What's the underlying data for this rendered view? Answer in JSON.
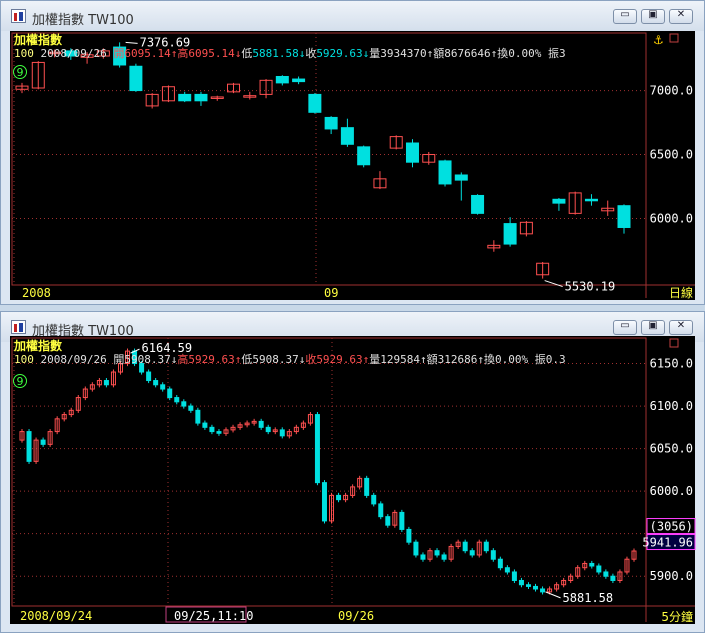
{
  "windows": [
    {
      "title": "加權指數 TW100",
      "symbol": "100",
      "date": "2008/09/26",
      "chart_name": "加權指數",
      "open_label": "開",
      "open": "6095.14",
      "high_label": "高",
      "high": "6095.14",
      "low_label": "低",
      "low": "5881.58",
      "close_label": "收",
      "close": "5929.63",
      "volume_label": "量",
      "volume": "3934370",
      "amount_label": "額",
      "amount": "8676646",
      "turnover_label": "換",
      "turnover": "0.00%",
      "amplitude_label": "振",
      "amplitude": "3",
      "arrow_up": "↑",
      "arrow_down": "↓",
      "marker": "9",
      "period": "日線",
      "x_labels": [
        "2008",
        "09"
      ],
      "high_annotation": "7376.69",
      "low_annotation": "5530.19"
    },
    {
      "title": "加權指數 TW100",
      "symbol": "100",
      "date": "2008/09/26",
      "chart_name": "加權指數",
      "open_label": "開",
      "open": "5908.37",
      "high_label": "高",
      "high": "5929.63",
      "low_label": "低",
      "low": "5908.37",
      "close_label": "收",
      "close": "5929.63",
      "volume_label": "量",
      "volume": "129584",
      "amount_label": "額",
      "amount": "312686",
      "turnover_label": "換",
      "turnover": "0.00%",
      "amplitude_label": "振",
      "amplitude": "0.3",
      "arrow_up": "↑",
      "arrow_down": "↓",
      "marker": "9",
      "period": "5分鐘",
      "x_labels": [
        "2008/09/24",
        "09/25,11:10",
        "09/26"
      ],
      "high_annotation": "6164.59",
      "low_annotation": "5881.58",
      "cursor_count": "(3056)",
      "cursor_price": "5941.96"
    }
  ],
  "controls": {
    "minimize": "▭",
    "restore": "▣",
    "close": "✕"
  },
  "colors": {
    "up": "#ff5050",
    "down": "#00e0e0",
    "grid": "#a03030",
    "axis": "#ffffff",
    "bg": "#000000"
  },
  "chart_data": [
    {
      "type": "candlestick",
      "title": "加權指數 TW100 日線",
      "ylim": [
        5480,
        7450
      ],
      "y_ticks": [
        6000.0,
        6500.0,
        7000.0
      ],
      "candles": [
        {
          "o": 7010,
          "h": 7060,
          "l": 6980,
          "c": 7035,
          "dir": "up"
        },
        {
          "o": 7020,
          "h": 7230,
          "l": 7010,
          "c": 7220,
          "dir": "up"
        },
        {
          "o": 7300,
          "h": 7320,
          "l": 7260,
          "c": 7300,
          "dir": "up"
        },
        {
          "o": 7310,
          "h": 7330,
          "l": 7240,
          "c": 7270,
          "dir": "down"
        },
        {
          "o": 7260,
          "h": 7300,
          "l": 7210,
          "c": 7280,
          "dir": "up"
        },
        {
          "o": 7270,
          "h": 7330,
          "l": 7250,
          "c": 7310,
          "dir": "up"
        },
        {
          "o": 7340,
          "h": 7376.69,
          "l": 7180,
          "c": 7200,
          "dir": "down"
        },
        {
          "o": 7190,
          "h": 7210,
          "l": 6990,
          "c": 7000,
          "dir": "down"
        },
        {
          "o": 6880,
          "h": 6980,
          "l": 6860,
          "c": 6970,
          "dir": "up"
        },
        {
          "o": 6920,
          "h": 7040,
          "l": 6910,
          "c": 7030,
          "dir": "up"
        },
        {
          "o": 6970,
          "h": 6990,
          "l": 6910,
          "c": 6920,
          "dir": "down"
        },
        {
          "o": 6970,
          "h": 6990,
          "l": 6880,
          "c": 6920,
          "dir": "down"
        },
        {
          "o": 6940,
          "h": 6960,
          "l": 6920,
          "c": 6950,
          "dir": "up"
        },
        {
          "o": 6990,
          "h": 7060,
          "l": 6980,
          "c": 7050,
          "dir": "up"
        },
        {
          "o": 6960,
          "h": 6990,
          "l": 6930,
          "c": 6950,
          "dir": "up"
        },
        {
          "o": 6970,
          "h": 7090,
          "l": 6940,
          "c": 7080,
          "dir": "up"
        },
        {
          "o": 7110,
          "h": 7120,
          "l": 7040,
          "c": 7060,
          "dir": "down"
        },
        {
          "o": 7090,
          "h": 7110,
          "l": 7050,
          "c": 7070,
          "dir": "down"
        },
        {
          "o": 6970,
          "h": 6980,
          "l": 6820,
          "c": 6830,
          "dir": "down"
        },
        {
          "o": 6790,
          "h": 6800,
          "l": 6660,
          "c": 6700,
          "dir": "down"
        },
        {
          "o": 6710,
          "h": 6780,
          "l": 6560,
          "c": 6580,
          "dir": "down"
        },
        {
          "o": 6560,
          "h": 6570,
          "l": 6400,
          "c": 6420,
          "dir": "down"
        },
        {
          "o": 6240,
          "h": 6370,
          "l": 6230,
          "c": 6310,
          "dir": "up"
        },
        {
          "o": 6550,
          "h": 6650,
          "l": 6540,
          "c": 6640,
          "dir": "up"
        },
        {
          "o": 6590,
          "h": 6620,
          "l": 6400,
          "c": 6440,
          "dir": "down"
        },
        {
          "o": 6440,
          "h": 6520,
          "l": 6420,
          "c": 6500,
          "dir": "up"
        },
        {
          "o": 6450,
          "h": 6460,
          "l": 6250,
          "c": 6270,
          "dir": "down"
        },
        {
          "o": 6340,
          "h": 6360,
          "l": 6140,
          "c": 6300,
          "dir": "down"
        },
        {
          "o": 6180,
          "h": 6190,
          "l": 6030,
          "c": 6040,
          "dir": "down"
        },
        {
          "o": 5770,
          "h": 5830,
          "l": 5740,
          "c": 5790,
          "dir": "up"
        },
        {
          "o": 5960,
          "h": 6010,
          "l": 5780,
          "c": 5800,
          "dir": "down"
        },
        {
          "o": 5880,
          "h": 5980,
          "l": 5860,
          "c": 5970,
          "dir": "up"
        },
        {
          "o": 5560,
          "h": 5660,
          "l": 5530.19,
          "c": 5650,
          "dir": "up"
        },
        {
          "o": 6150,
          "h": 6160,
          "l": 6060,
          "c": 6120,
          "dir": "down"
        },
        {
          "o": 6040,
          "h": 6210,
          "l": 6030,
          "c": 6200,
          "dir": "up"
        },
        {
          "o": 6150,
          "h": 6190,
          "l": 6100,
          "c": 6150,
          "dir": "down"
        },
        {
          "o": 6060,
          "h": 6140,
          "l": 6020,
          "c": 6080,
          "dir": "up"
        },
        {
          "o": 6100,
          "h": 6110,
          "l": 5881.58,
          "c": 5929.63,
          "dir": "down"
        }
      ]
    },
    {
      "type": "candlestick",
      "title": "加權指數 TW100 5分鐘",
      "ylim": [
        5865,
        6180
      ],
      "y_ticks": [
        5900.0,
        5950.0,
        6000.0,
        6050.0,
        6100.0,
        6150.0
      ],
      "close_series": [
        6070,
        6035,
        6060,
        6055,
        6070,
        6085,
        6090,
        6095,
        6110,
        6120,
        6125,
        6130,
        6125,
        6140,
        6150,
        6164.59,
        6150,
        6140,
        6130,
        6125,
        6120,
        6110,
        6105,
        6100,
        6095,
        6080,
        6075,
        6070,
        6068,
        6072,
        6075,
        6078,
        6080,
        6082,
        6075,
        6070,
        6072,
        6065,
        6070,
        6075,
        6080,
        6090,
        6010,
        5965,
        5995,
        5990,
        5995,
        6005,
        6015,
        5995,
        5985,
        5970,
        5960,
        5975,
        5955,
        5940,
        5925,
        5920,
        5930,
        5925,
        5920,
        5935,
        5940,
        5930,
        5925,
        5940,
        5930,
        5920,
        5910,
        5905,
        5895,
        5890,
        5888,
        5885,
        5881.58,
        5885,
        5890,
        5895,
        5900,
        5910,
        5915,
        5912,
        5905,
        5900,
        5895,
        5905,
        5920,
        5929.63
      ]
    }
  ]
}
